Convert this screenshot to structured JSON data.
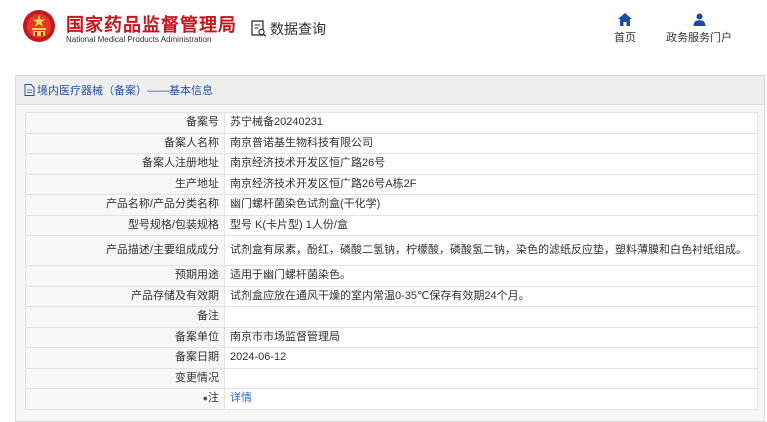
{
  "header": {
    "title_cn": "国家药品监督管理局",
    "title_en": "National Medical Products Administration",
    "query_label": "数据查询",
    "nav": [
      {
        "label": "首页",
        "icon": "home-icon"
      },
      {
        "label": "政务服务门户",
        "icon": "user-icon"
      }
    ]
  },
  "breadcrumb": "境内医疗器械（备案）——基本信息",
  "rows": [
    {
      "key": "备案号",
      "value": "苏宁械备20240231"
    },
    {
      "key": "备案人名称",
      "value": "南京普诺基生物科技有限公司"
    },
    {
      "key": "备案人注册地址",
      "value": "南京经济技术开发区恒广路26号"
    },
    {
      "key": "生产地址",
      "value": "南京经济技术开发区恒广路26号A栋2F"
    },
    {
      "key": "产品名称/产品分类名称",
      "value": "幽门螺杆菌染色试剂盒(干化学)"
    },
    {
      "key": "型号规格/包装规格",
      "value": "型号 K(卡片型) 1人份/盒"
    },
    {
      "key": "产品描述/主要组成成分",
      "value": "试剂盒有尿素，酚红，磷酸二氢钠，柠檬酸，磷酸氢二钠，染色的滤纸反应垫，塑料薄膜和白色衬纸组成。"
    },
    {
      "key": "预期用途",
      "value": "适用于幽门螺杆菌染色。"
    },
    {
      "key": "产品存储及有效期",
      "value": "试剂盒应放在通风干燥的室内常温0-35℃保存有效期24个月。"
    },
    {
      "key": "备注",
      "value": ""
    },
    {
      "key": "备案单位",
      "value": "南京市市场监督管理局"
    },
    {
      "key": "备案日期",
      "value": "2024-06-12"
    },
    {
      "key": "变更情况",
      "value": ""
    },
    {
      "key": "注",
      "value": "详情"
    }
  ],
  "colors": {
    "brand_red": "#c8161d",
    "link_blue": "#2450a8",
    "nav_icon": "#1d4f9e"
  }
}
